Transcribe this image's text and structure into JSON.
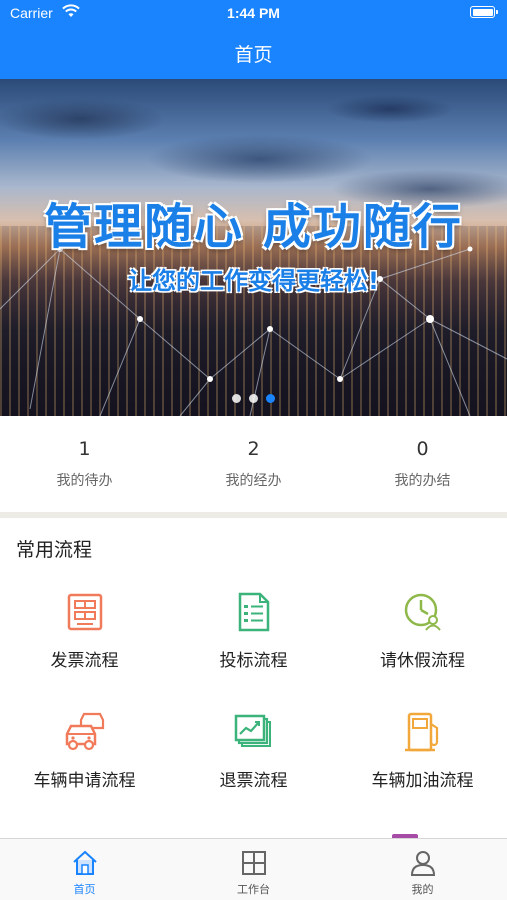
{
  "status_bar": {
    "carrier": "Carrier",
    "time": "1:44 PM"
  },
  "nav": {
    "title": "首页"
  },
  "banner": {
    "headline": "管理随心 成功随行",
    "tagline": "让您的工作变得更轻松!",
    "slide_count": 3,
    "active_slide": 3
  },
  "stats": [
    {
      "value": "1",
      "label": "我的待办"
    },
    {
      "value": "2",
      "label": "我的经办"
    },
    {
      "value": "0",
      "label": "我的办结"
    }
  ],
  "common": {
    "title": "常用流程",
    "items": [
      {
        "label": "发票流程",
        "icon": "invoice-icon",
        "color": "#f07a5a"
      },
      {
        "label": "投标流程",
        "icon": "bid-document-icon",
        "color": "#3bb37a"
      },
      {
        "label": "请休假流程",
        "icon": "leave-clock-icon",
        "color": "#8fb84a"
      },
      {
        "label": "车辆申请流程",
        "icon": "cars-icon",
        "color": "#f07a5a"
      },
      {
        "label": "退票流程",
        "icon": "refund-chart-icon",
        "color": "#3bb37a"
      },
      {
        "label": "车辆加油流程",
        "icon": "fuel-pump-icon",
        "color": "#f2a73b"
      }
    ]
  },
  "tabbar": [
    {
      "label": "首页",
      "icon": "home-icon",
      "active": true
    },
    {
      "label": "工作台",
      "icon": "grid-icon",
      "active": false
    },
    {
      "label": "我的",
      "icon": "user-icon",
      "active": false
    }
  ],
  "colors": {
    "primary": "#1a84ff",
    "divider": "#ecebe6"
  }
}
